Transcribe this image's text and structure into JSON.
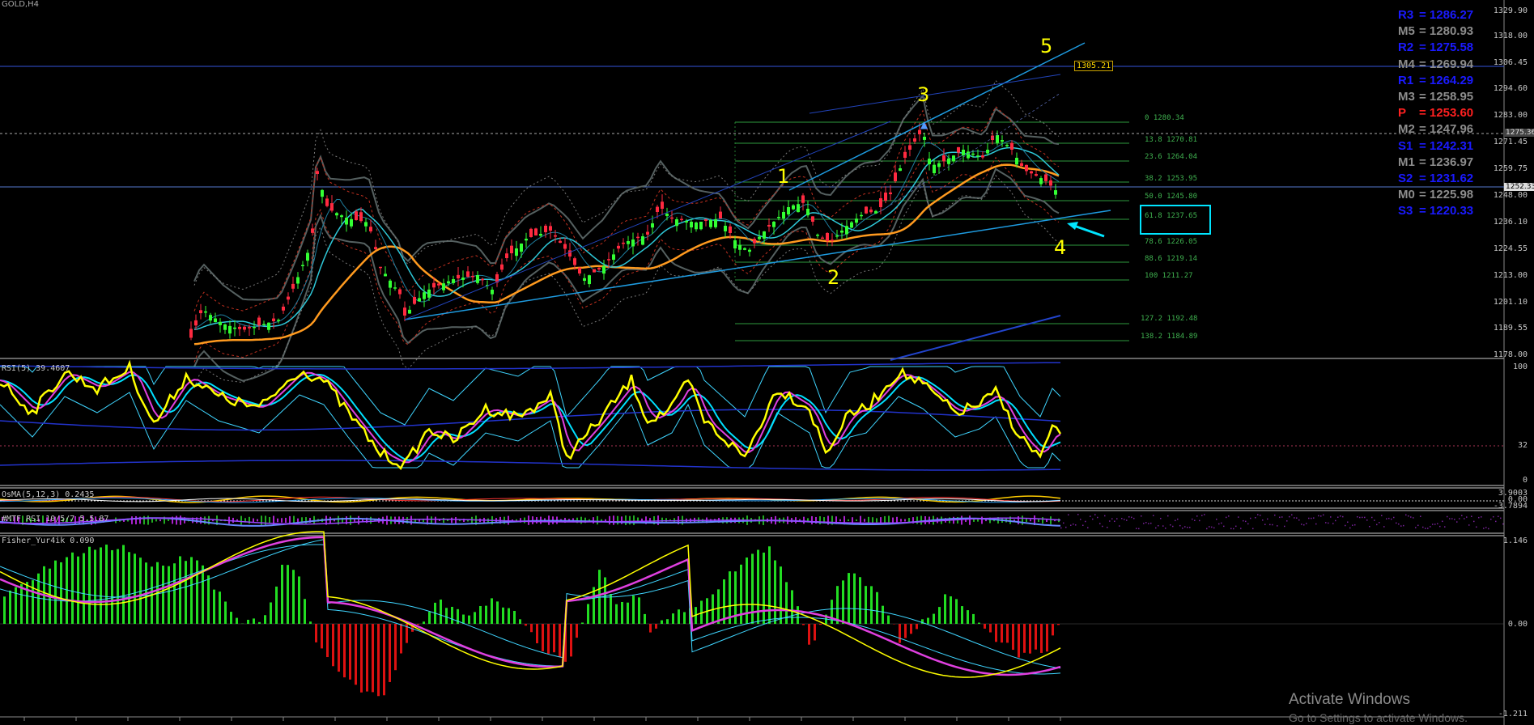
{
  "chart_title": "GOLD,H4",
  "price_axis": [
    "1329.90",
    "1318.00",
    "1306.45",
    "1294.60",
    "1283.00",
    "1271.45",
    "1259.75",
    "1248.00",
    "1236.10",
    "1224.55",
    "1213.00",
    "1201.10",
    "1189.55",
    "1178.00"
  ],
  "price_tags": {
    "current": "1252.33",
    "upper": "1275.36",
    "line_tag": "1305.21"
  },
  "pivots": [
    {
      "name": "R3",
      "value": "= 1286.27",
      "color": "#1a1aff"
    },
    {
      "name": "M5",
      "value": "= 1280.93",
      "color": "#8c8c8c"
    },
    {
      "name": "R2",
      "value": "= 1275.58",
      "color": "#1a1aff"
    },
    {
      "name": "M4",
      "value": "= 1269.94",
      "color": "#8c8c8c"
    },
    {
      "name": "R1",
      "value": "= 1264.29",
      "color": "#1a1aff"
    },
    {
      "name": "M3",
      "value": "= 1258.95",
      "color": "#8c8c8c"
    },
    {
      "name": "P",
      "value": "= 1253.60",
      "color": "#ff2020"
    },
    {
      "name": "M2",
      "value": "= 1247.96",
      "color": "#8c8c8c"
    },
    {
      "name": "S1",
      "value": "= 1242.31",
      "color": "#1a1aff"
    },
    {
      "name": "M1",
      "value": "= 1236.97",
      "color": "#8c8c8c"
    },
    {
      "name": "S2",
      "value": "= 1231.62",
      "color": "#1a1aff"
    },
    {
      "name": "M0",
      "value": "= 1225.98",
      "color": "#8c8c8c"
    },
    {
      "name": "S3",
      "value": "= 1220.33",
      "color": "#1a1aff"
    }
  ],
  "fib_levels": [
    "0 1280.34",
    "13.8 1270.81",
    "23.6 1264.04",
    "38.2 1253.95",
    "50.0 1245.80",
    "61.8 1237.65",
    "78.6 1226.05",
    "88.6 1219.14",
    "100 1211.27",
    "127.2 1192.48",
    "138.2 1184.89"
  ],
  "waves": [
    "1",
    "2",
    "3",
    "4",
    "5"
  ],
  "indicators": {
    "rsi_label": "RSI(5) 39.4607",
    "rsi_levels": [
      "100",
      "32",
      "0"
    ],
    "osma_label": "OsMA(5,12,3) 0.2435",
    "osma_levels": [
      "3.9003",
      "0.00",
      "-3.7894"
    ],
    "mtf_label": "#MTF_RSI 10/5/7 5.5.87",
    "fisher_label": "Fisher_Yur4ik 0.090",
    "fisher_levels": [
      "1.146",
      "0.00",
      "-1.211"
    ]
  },
  "watermark": {
    "title": "Activate Windows",
    "subtitle": "Go to Settings to activate Windows."
  },
  "colors": {
    "background": "#000000",
    "bull": "#33ff33",
    "bear": "#ff2a40",
    "ma_orange": "#ff9a1f",
    "ma_cyan": "#2ec8d8",
    "rsi": "#ffff00",
    "fisher_up": "#22dd22",
    "fisher_down": "#dd1111"
  }
}
